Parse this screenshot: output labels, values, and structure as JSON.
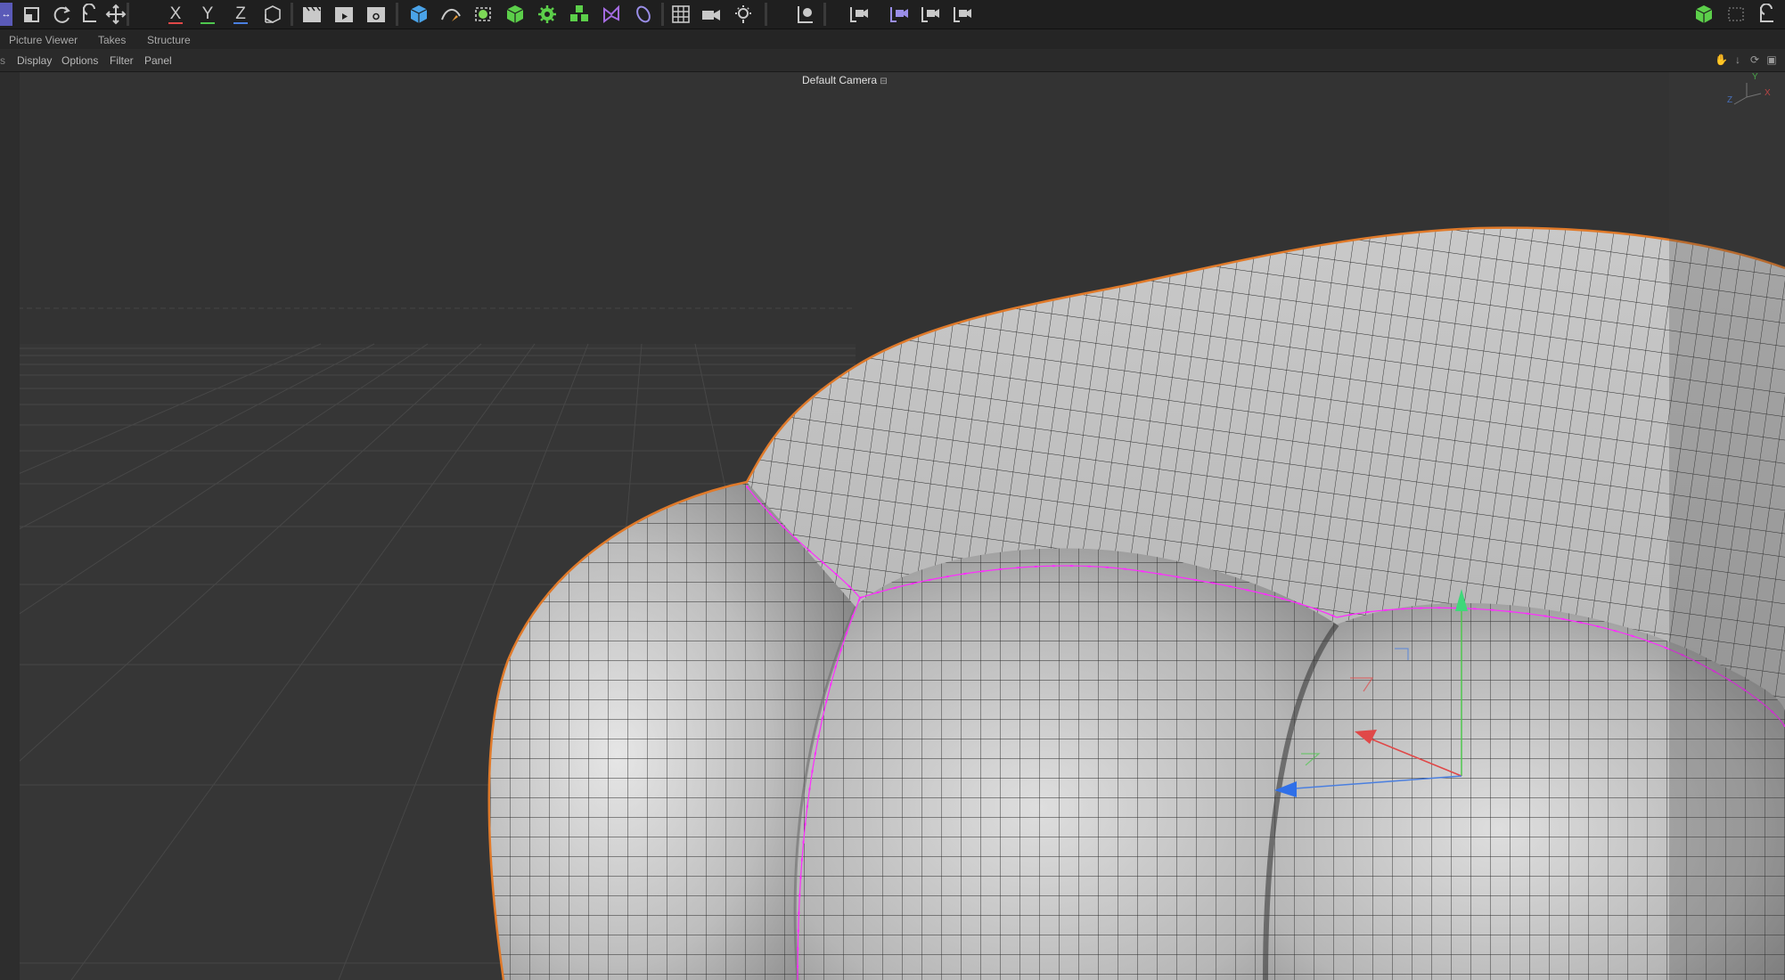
{
  "toolbar": {
    "axis_x": "X",
    "axis_y": "Y",
    "axis_z": "Z",
    "colors": {
      "x": "#e04848",
      "y": "#4ec74e",
      "z": "#4a7fe0",
      "accent": "#6b6bd6"
    }
  },
  "tabs": {
    "picture_viewer": "Picture Viewer",
    "takes": "Takes",
    "structure": "Structure"
  },
  "menu": {
    "display": "Display",
    "options": "Options",
    "filter": "Filter",
    "panel": "Panel"
  },
  "viewport": {
    "camera": "Default Camera",
    "axis_labels": {
      "y": "Y",
      "x": "X",
      "z": "Z"
    },
    "selection_color": "#ff2cff",
    "outline_color": "#e07a2a"
  }
}
